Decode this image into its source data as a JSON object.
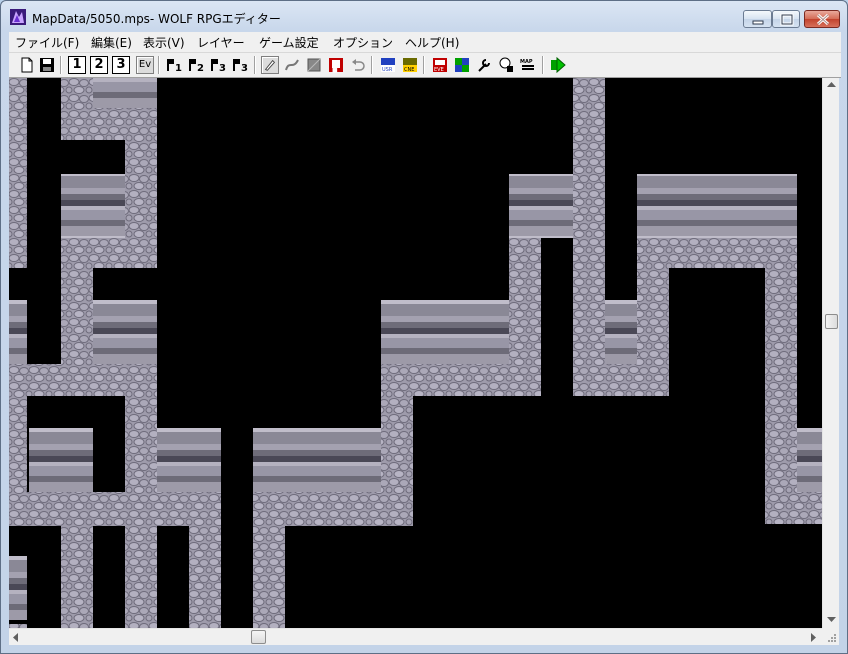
{
  "window": {
    "title": "MapData/5050.mps- WOLF RPGエディター",
    "controls": {
      "minimize": "minimize",
      "maximize": "maximize",
      "close": "close"
    }
  },
  "menu": [
    {
      "label": "ファイル(F)"
    },
    {
      "label": "編集(E)"
    },
    {
      "label": "表示(V)"
    },
    {
      "label": "レイヤー"
    },
    {
      "label": "ゲーム設定"
    },
    {
      "label": "オプション"
    },
    {
      "label": "ヘルプ(H)"
    }
  ],
  "toolbar": {
    "layer_buttons": [
      "1",
      "2",
      "3",
      "Ev"
    ],
    "active_layer": "Ev",
    "icons": [
      "new-file-icon",
      "save-icon",
      "layer-1-button",
      "layer-2-button",
      "layer-3-button",
      "event-layer-button",
      "tile-1-icon",
      "tile-2-icon",
      "tile-3-icon",
      "tile-4-icon",
      "pen-icon",
      "line-icon",
      "fill-icon",
      "erase-icon",
      "undo-icon",
      "database-user-icon",
      "database-sys-icon",
      "common-event-icon",
      "tileset-icon",
      "tool-icon",
      "character-icon",
      "map-list-icon",
      "test-play-icon"
    ],
    "colors": {
      "green_play": "#00a000",
      "red": "#c00000",
      "blue": "#2040c0"
    }
  },
  "map": {
    "background": "#000000",
    "wall_color": "#8a8894",
    "stone_color": "#a29fae"
  }
}
